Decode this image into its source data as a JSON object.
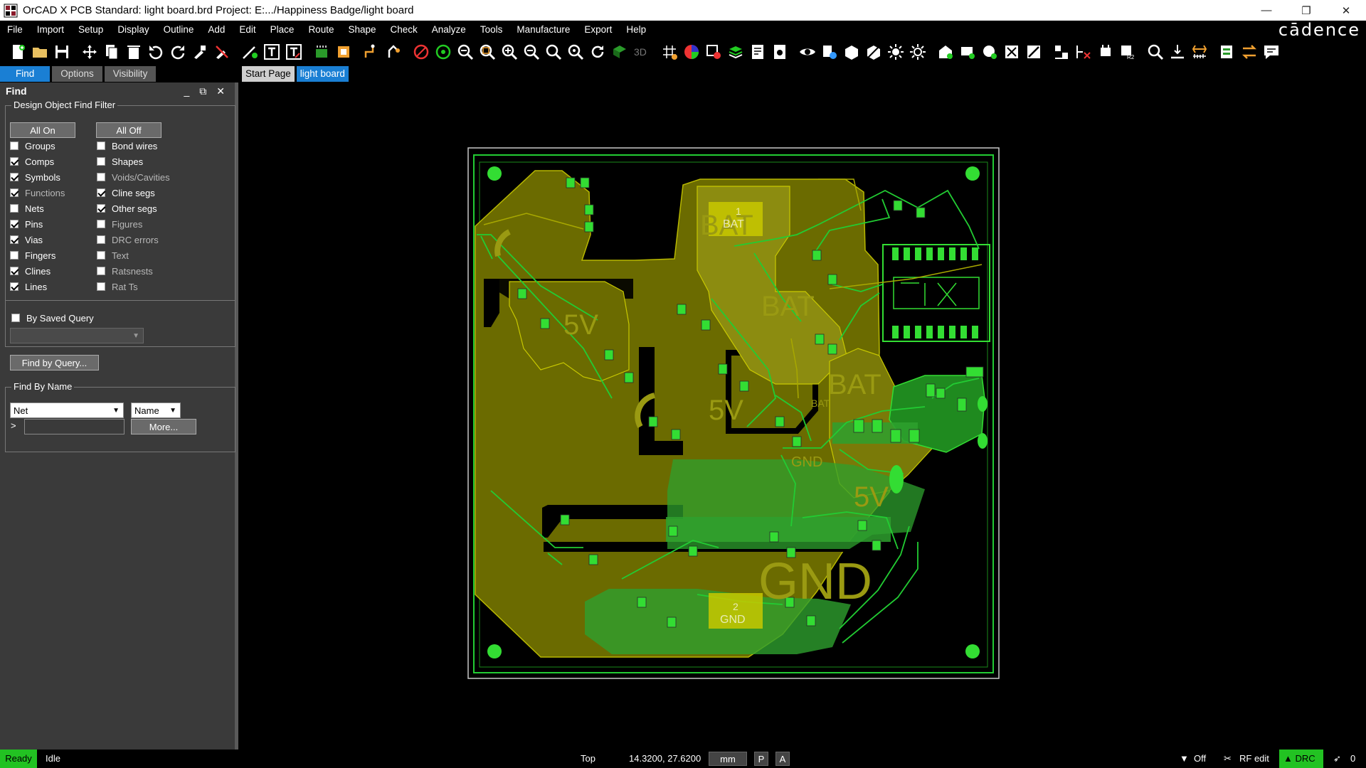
{
  "window": {
    "title": "OrCAD X PCB Standard: light board.brd  Project: E:.../Happiness Badge/light board",
    "controls": [
      "—",
      "❐",
      "✕"
    ]
  },
  "menu": {
    "items": [
      "File",
      "Import",
      "Setup",
      "Display",
      "Outline",
      "Add",
      "Edit",
      "Place",
      "Route",
      "Shape",
      "Check",
      "Analyze",
      "Tools",
      "Manufacture",
      "Export",
      "Help"
    ],
    "brand": "cādence"
  },
  "panel_tabs": [
    "Find",
    "Options",
    "Visibility"
  ],
  "doc_tabs": [
    "Start Page",
    "light board"
  ],
  "find_panel": {
    "title": "Find",
    "filter_title": "Design Object Find Filter",
    "all_on": "All On",
    "all_off": "All Off",
    "left_items": [
      {
        "label": "Groups",
        "checked": false
      },
      {
        "label": "Comps",
        "checked": true
      },
      {
        "label": "Symbols",
        "checked": true
      },
      {
        "label": "Functions",
        "checked": true,
        "disabled": true
      },
      {
        "label": "Nets",
        "checked": false
      },
      {
        "label": "Pins",
        "checked": true
      },
      {
        "label": "Vias",
        "checked": true
      },
      {
        "label": "Fingers",
        "checked": false
      },
      {
        "label": "Clines",
        "checked": true
      },
      {
        "label": "Lines",
        "checked": true
      }
    ],
    "right_items": [
      {
        "label": "Bond wires",
        "checked": false
      },
      {
        "label": "Shapes",
        "checked": false
      },
      {
        "label": "Voids/Cavities",
        "checked": false,
        "disabled": true
      },
      {
        "label": "Cline segs",
        "checked": true
      },
      {
        "label": "Other segs",
        "checked": true
      },
      {
        "label": "Figures",
        "checked": false,
        "disabled": true
      },
      {
        "label": "DRC errors",
        "checked": false,
        "disabled": true
      },
      {
        "label": "Text",
        "checked": false,
        "disabled": true
      },
      {
        "label": "Ratsnests",
        "checked": false,
        "disabled": true
      },
      {
        "label": "Rat Ts",
        "checked": false,
        "disabled": true
      }
    ],
    "saved_query_label": "By Saved Query",
    "saved_query_value": "",
    "find_by_query": "Find by Query...",
    "find_by_name_title": "Find By Name",
    "type_select": "Net",
    "name_select": "Name",
    "prompt": ">",
    "name_value": "",
    "more_button": "More..."
  },
  "board": {
    "labels": [
      "BAT",
      "BAT",
      "BAT",
      "5V",
      "5V",
      "5V",
      "GND",
      "GND",
      "BAT",
      "BAT",
      "GND",
      "1",
      "2"
    ],
    "colors": {
      "copper": "#6b6b00",
      "copper_light": "#8c8c10",
      "trace": "#22cc33",
      "pad": "#33dd33",
      "outline": "#c8c8c8",
      "label": "#9a9a12"
    }
  },
  "status": {
    "ready": "Ready",
    "idle": "Idle",
    "layer": "Top",
    "coords": "14.3200, 27.6200",
    "units": "mm",
    "p": "P",
    "a": "A",
    "filter": "Off",
    "rf_edit": "RF edit",
    "drc": "DRC",
    "count": "0"
  }
}
